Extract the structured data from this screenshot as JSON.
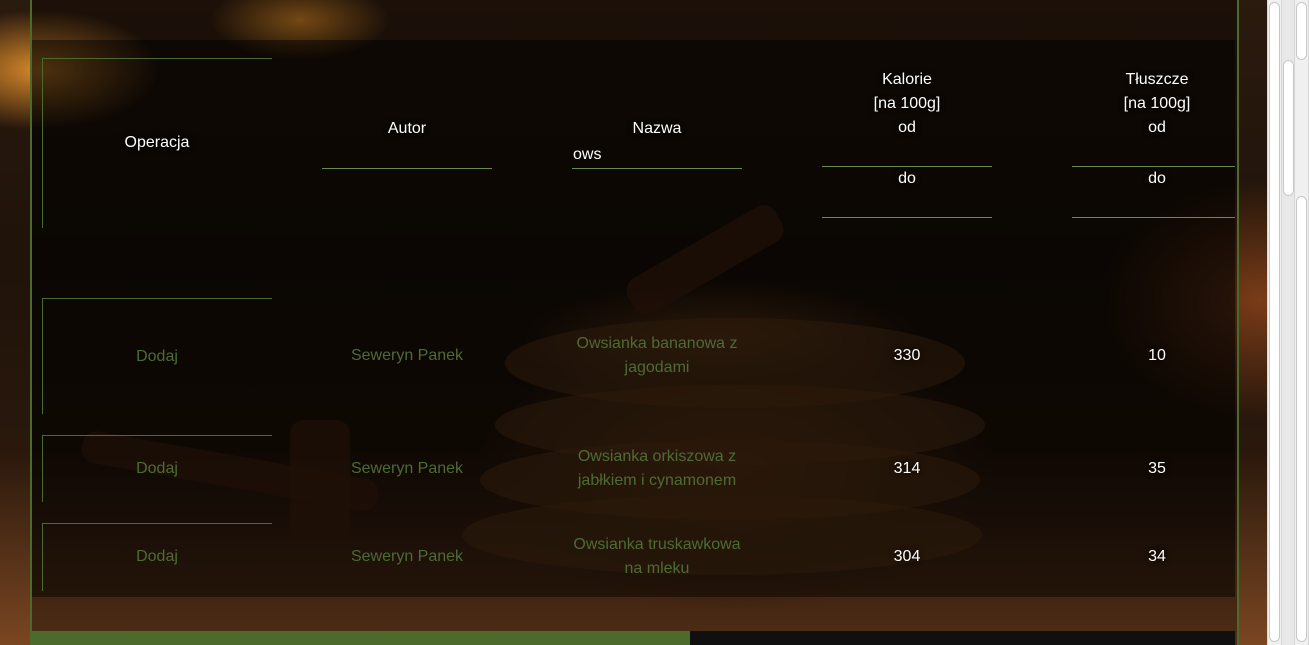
{
  "table": {
    "headers": {
      "operation": "Operacja",
      "author": "Autor",
      "name": "Nazwa",
      "calories_lines": [
        "Kalorie",
        "[na 100g]",
        "od"
      ],
      "calories_to": "do",
      "fat_lines": [
        "Tłuszcze",
        "[na 100g]",
        "od"
      ],
      "fat_to": "do"
    },
    "filters": {
      "author_value": "",
      "name_value": "ows",
      "calories_from": "",
      "calories_to": "",
      "fat_from": "",
      "fat_to": ""
    },
    "rows": [
      {
        "action": "Dodaj",
        "author": "Seweryn Panek",
        "name_lines": [
          "Owsianka bananowa z",
          "jagodami"
        ],
        "calories": "330",
        "fat": "10"
      },
      {
        "action": "Dodaj",
        "author": "Seweryn Panek",
        "name_lines": [
          "Owsianka orkiszowa z",
          "jabłkiem i cynamonem"
        ],
        "calories": "314",
        "fat": "35"
      },
      {
        "action": "Dodaj",
        "author": "Seweryn Panek",
        "name_lines": [
          "Owsianka truskawkowa",
          "na mleku"
        ],
        "calories": "304",
        "fat": "34"
      }
    ]
  },
  "progress": {
    "fraction": 0.547
  },
  "colors": {
    "accent": "#4b6a2c",
    "link": "#4e6b34"
  }
}
